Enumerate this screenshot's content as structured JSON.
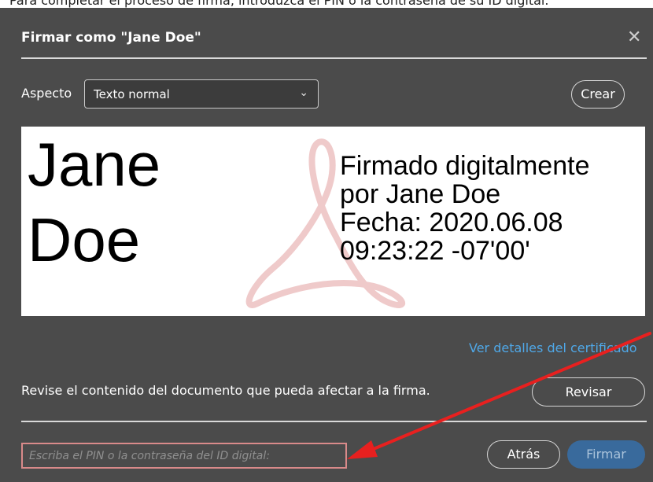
{
  "page_top_text": "Para completar el proceso de firma, introduzca el PIN o la contraseña de su ID digital.",
  "dialog": {
    "title": "Firmar como \"Jane Doe\"",
    "close_icon": "close-icon"
  },
  "aspect": {
    "label": "Aspecto",
    "selected": "Texto normal",
    "create_label": "Crear"
  },
  "preview": {
    "name_line1": "Jane",
    "name_line2": "Doe",
    "details": [
      "Firmado digitalmente",
      "por Jane Doe",
      "Fecha: 2020.06.08",
      "09:23:22 -07'00'"
    ],
    "watermark_icon": "adobe-acrobat-logo",
    "watermark_color": "#e8b4b4"
  },
  "cert_link": "Ver detalles del certificado",
  "review": {
    "text": "Revise el contenido del documento que pueda afectar a la firma.",
    "button_label": "Revisar"
  },
  "pin": {
    "placeholder": "Escriba el PIN o la contraseña del ID digital:",
    "value": ""
  },
  "footer": {
    "back_label": "Atrás",
    "sign_label": "Firmar"
  },
  "colors": {
    "dialog_bg": "#4b4b4b",
    "link": "#4fa8e8",
    "primary_button": "#396a9c",
    "annotation_arrow": "#e8201f",
    "pin_border": "#d98a8a"
  }
}
